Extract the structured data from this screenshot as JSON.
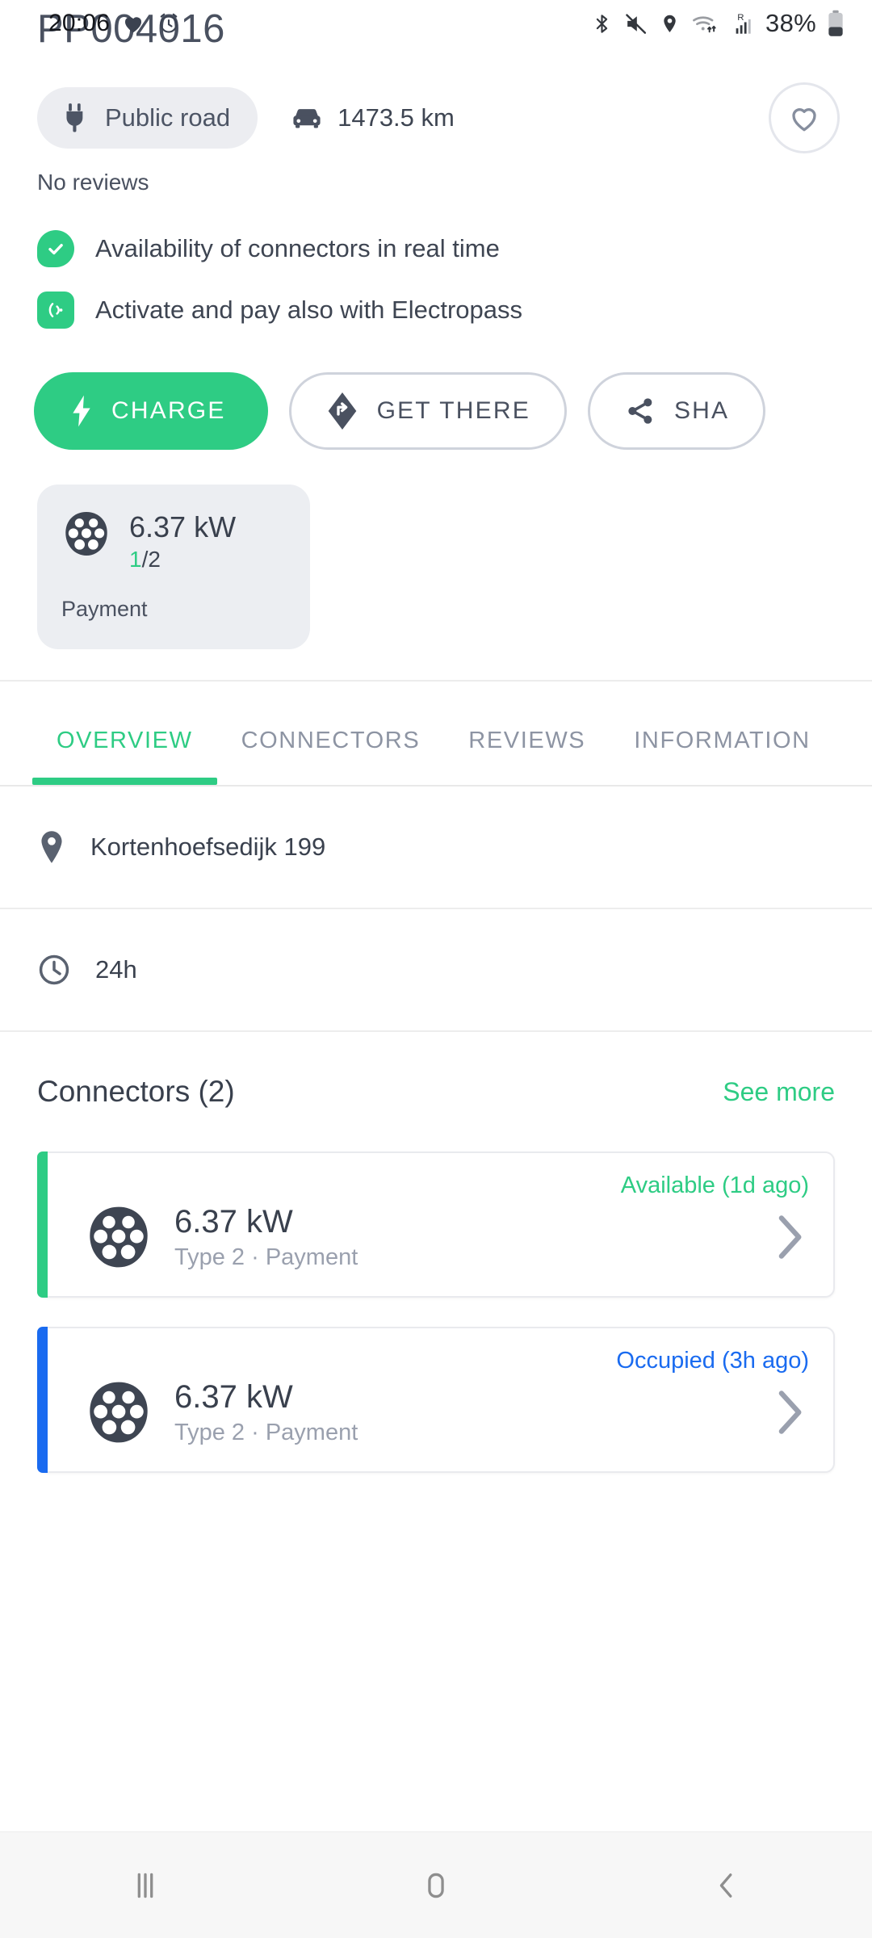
{
  "status_bar": {
    "time": "20:06",
    "battery_percent": "38%",
    "icons": [
      "heart-icon",
      "alarm-icon",
      "bluetooth-icon",
      "mute-icon",
      "location-icon",
      "wifi-icon",
      "roaming-signal-icon",
      "battery-icon"
    ]
  },
  "header": {
    "title": "PP004016"
  },
  "meta": {
    "access_chip": {
      "label": "Public road",
      "icon": "plug-icon"
    },
    "distance": {
      "label": "1473.5 km",
      "icon": "car-icon"
    },
    "favorite": {
      "icon": "heart-outline-icon"
    }
  },
  "reviews": {
    "label": "No reviews"
  },
  "features": [
    {
      "label": "Availability of connectors in real time",
      "icon": "check-badge-icon"
    },
    {
      "label": "Activate and pay also with Electropass",
      "icon": "nfc-badge-icon"
    }
  ],
  "actions": [
    {
      "label": "CHARGE",
      "icon": "bolt-icon",
      "style": "primary"
    },
    {
      "label": "GET THERE",
      "icon": "navigation-icon",
      "style": "outline"
    },
    {
      "label": "SHA",
      "icon": "share-icon",
      "style": "outline"
    }
  ],
  "power_card": {
    "icon": "type2-connector-icon",
    "power": "6.37 kW",
    "available_count": "1",
    "separator": "/",
    "total_count": "2",
    "payment_label": "Payment"
  },
  "tabs": [
    {
      "label": "OVERVIEW",
      "active": true
    },
    {
      "label": "CONNECTORS",
      "active": false
    },
    {
      "label": "REVIEWS",
      "active": false
    },
    {
      "label": "INFORMATION",
      "active": false
    }
  ],
  "info_rows": [
    {
      "label": "Kortenhoefsedijk 199",
      "icon": "map-pin-icon"
    },
    {
      "label": "24h",
      "icon": "clock-icon"
    }
  ],
  "connectors_section": {
    "title": "Connectors (2)",
    "see_more": "See more",
    "items": [
      {
        "status": "Available (1d ago)",
        "status_color": "#2ecc84",
        "bar_color": "#2ecc84",
        "power": "6.37 kW",
        "subtitle": "Type 2 · Payment",
        "icon": "type2-connector-icon",
        "chevron": "chevron-right-icon"
      },
      {
        "status": "Occupied (3h ago)",
        "status_color": "#1a6bf0",
        "bar_color": "#1a6bf0",
        "power": "6.37 kW",
        "subtitle": "Type 2 · Payment",
        "icon": "type2-connector-icon",
        "chevron": "chevron-right-icon"
      }
    ]
  },
  "navigation_bar": {
    "recents": "recents-icon",
    "home": "home-icon",
    "back": "back-icon"
  },
  "colors": {
    "accent_green": "#2ecc84",
    "occupied_blue": "#1a6bf0",
    "text_dark": "#39404d",
    "text_muted": "#9aa0ae"
  }
}
